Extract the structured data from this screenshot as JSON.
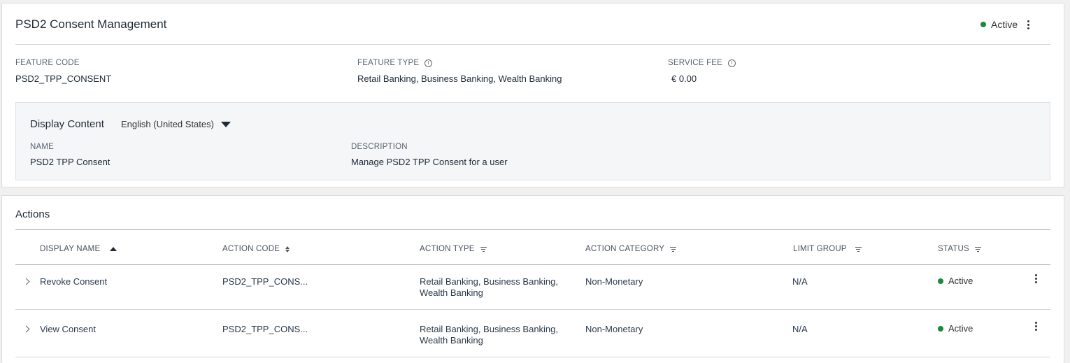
{
  "feature": {
    "title": "PSD2 Consent Management",
    "status": "Active",
    "fields": {
      "feature_code_label": "FEATURE CODE",
      "feature_code": "PSD2_TPP_CONSENT",
      "feature_type_label": "FEATURE TYPE",
      "feature_type": "Retail Banking, Business Banking, Wealth Banking",
      "service_fee_label": "SERVICE FEE",
      "service_fee": "€ 0.00"
    },
    "display_content": {
      "title": "Display Content",
      "language": "English (United States)",
      "name_label": "NAME",
      "name": "PSD2 TPP Consent",
      "description_label": "DESCRIPTION",
      "description": "Manage PSD2 TPP Consent for a user"
    }
  },
  "actions": {
    "title": "Actions",
    "columns": {
      "display_name": "DISPLAY NAME",
      "action_code": "ACTION CODE",
      "action_type": "ACTION TYPE",
      "action_category": "ACTION CATEGORY",
      "limit_group": "LIMIT GROUP",
      "status": "STATUS"
    },
    "rows": [
      {
        "display_name": "Revoke Consent",
        "action_code": "PSD2_TPP_CONS...",
        "action_type_line1": "Retail Banking, Business Banking,",
        "action_type_line2": "Wealth Banking",
        "action_category": "Non-Monetary",
        "limit_group": "N/A",
        "status": "Active"
      },
      {
        "display_name": "View Consent",
        "action_code": "PSD2_TPP_CONS...",
        "action_type_line1": "Retail Banking, Business Banking,",
        "action_type_line2": "Wealth Banking",
        "action_category": "Non-Monetary",
        "limit_group": "N/A",
        "status": "Active"
      }
    ]
  },
  "colors": {
    "status_active": "#1a8a3c",
    "text_primary": "#1f2a36",
    "panel_bg": "#f5f6f8"
  },
  "icons": [
    "info-icon",
    "kebab-menu-icon",
    "caret-down-icon",
    "sort-asc-icon",
    "sort-icon",
    "filter-icon",
    "chevron-right-icon",
    "status-dot-icon"
  ]
}
